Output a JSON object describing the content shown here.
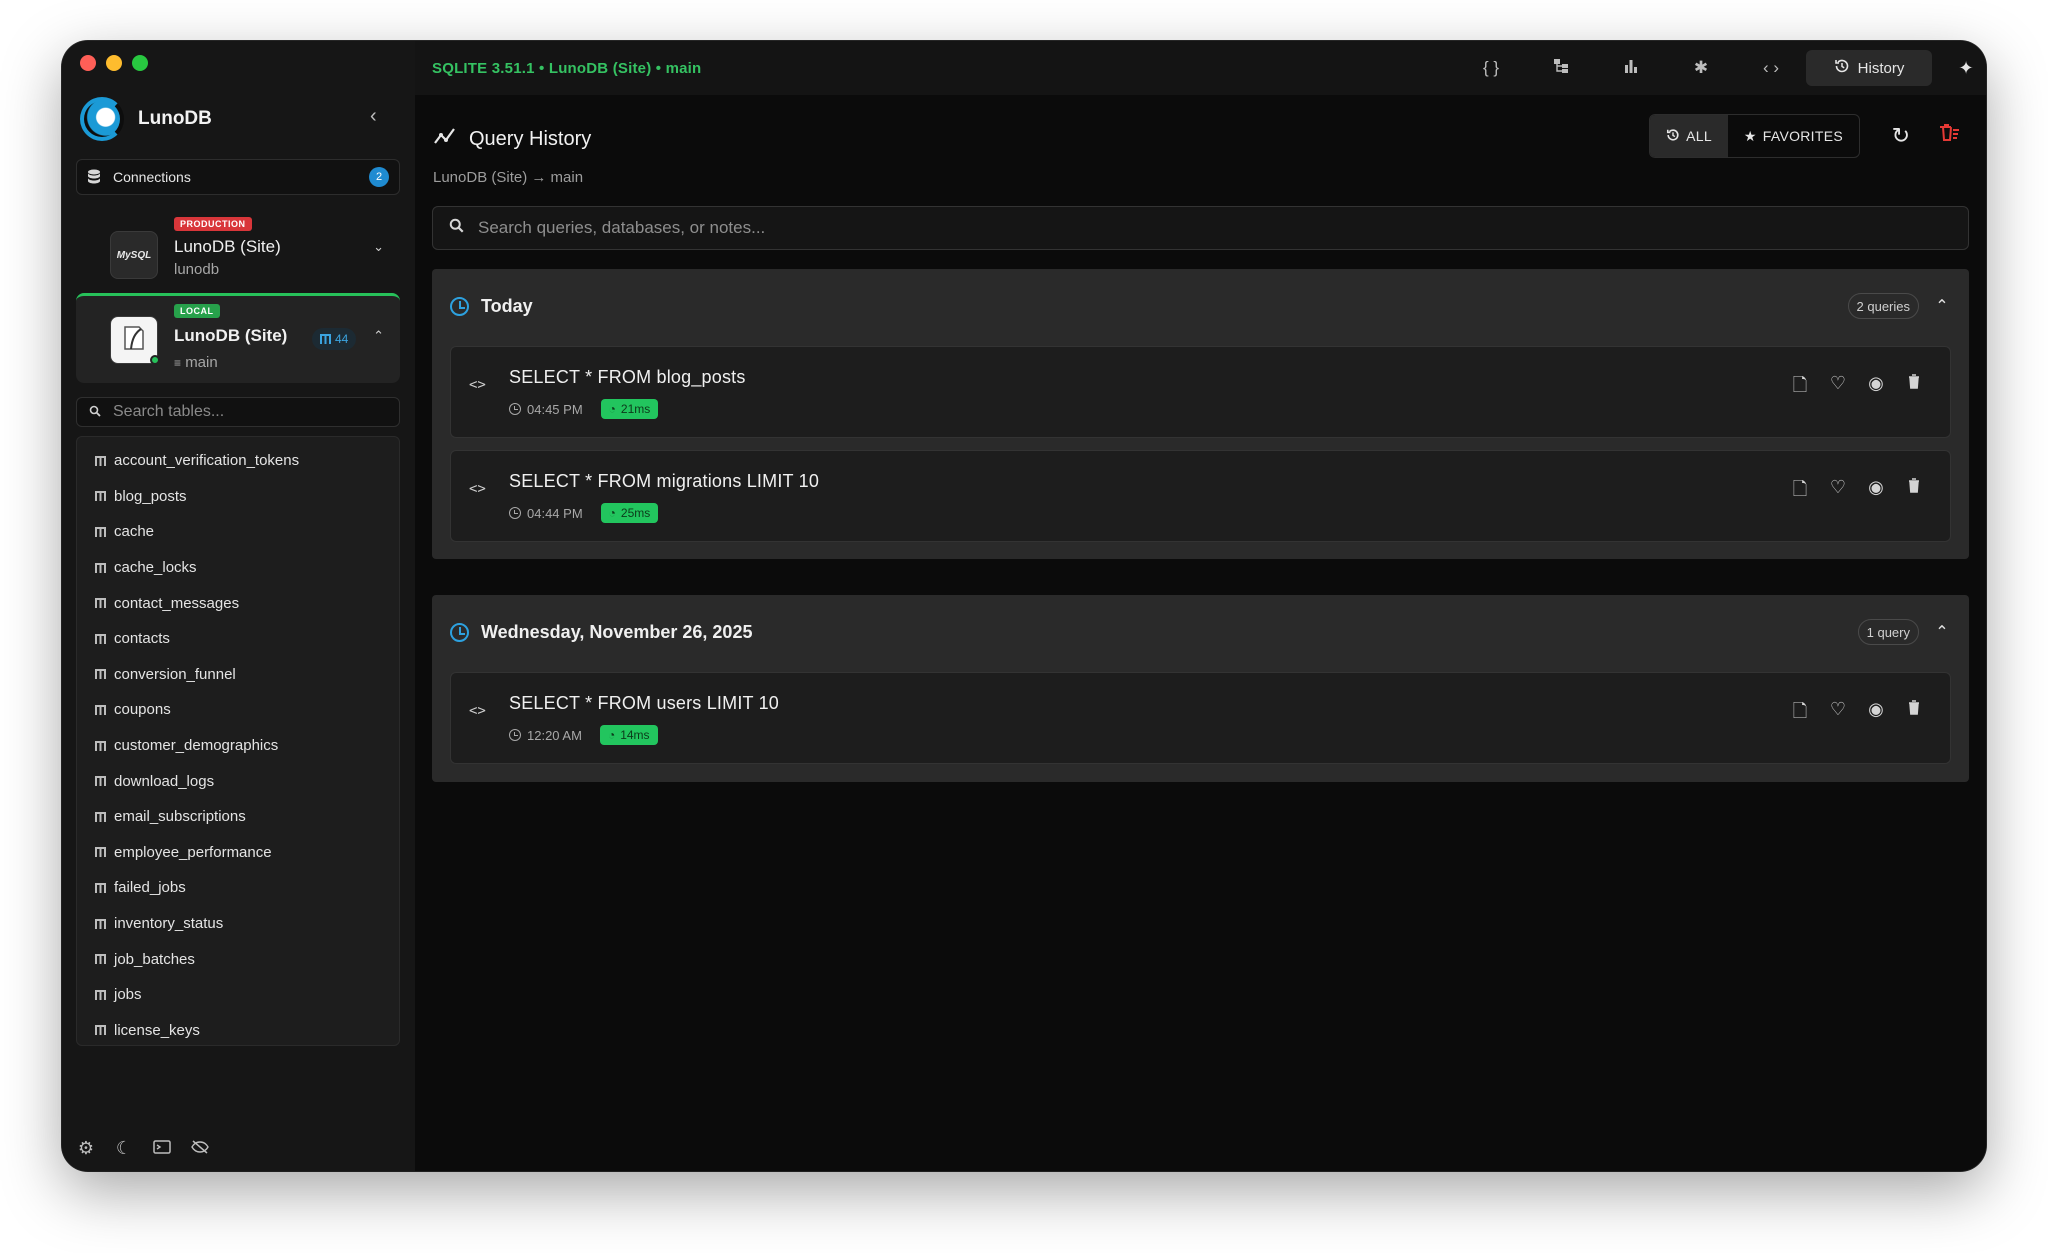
{
  "sidebar": {
    "brand": "LunoDB",
    "collapse_icon": "chevron-left-icon",
    "connections_label": "Connections",
    "connections_count": "2",
    "connections_list": [
      {
        "env": "PRODUCTION",
        "name": "LunoDB (Site)",
        "sub": "lunodb",
        "engine": "MySQL",
        "env_color": "#d9363a"
      },
      {
        "env": "LOCAL",
        "name": "LunoDB (Site)",
        "sub": "main",
        "engine": "SQLite",
        "table_count": "44",
        "env_color": "#27a14b"
      }
    ],
    "table_search_placeholder": "Search tables...",
    "tables": [
      "account_verification_tokens",
      "blog_posts",
      "cache",
      "cache_locks",
      "contact_messages",
      "contacts",
      "conversion_funnel",
      "coupons",
      "customer_demographics",
      "download_logs",
      "email_subscriptions",
      "employee_performance",
      "failed_jobs",
      "inventory_status",
      "job_batches",
      "jobs",
      "license_keys"
    ],
    "footer_icons": [
      "gear-icon",
      "moon-icon",
      "terminal-icon",
      "eye-off-icon"
    ]
  },
  "topbar": {
    "connection_status": "SQLITE 3.51.1 • LunoDB (Site) • main",
    "icons": [
      "braces-icon",
      "schema-icon",
      "chart-icon",
      "graph-icon",
      "code-icon"
    ],
    "history_label": "History",
    "ai_icon": "sparkle-icon"
  },
  "page": {
    "title": "Query History",
    "breadcrumb": "LunoDB (Site) → main",
    "filter_all": "ALL",
    "filter_favorites": "FAVORITES",
    "search_placeholder": "Search queries, databases, or notes..."
  },
  "groups": [
    {
      "title": "Today",
      "count": "2 queries",
      "queries": [
        {
          "sql": "SELECT * FROM blog_posts",
          "time": "04:45 PM",
          "duration": "21ms"
        },
        {
          "sql": "SELECT * FROM migrations LIMIT 10",
          "time": "04:44 PM",
          "duration": "25ms"
        }
      ]
    },
    {
      "title": "Wednesday, November 26, 2025",
      "count": "1 query",
      "queries": [
        {
          "sql": "SELECT * FROM users LIMIT 10",
          "time": "12:20 AM",
          "duration": "14ms"
        }
      ]
    }
  ],
  "colors": {
    "accent_green": "#22c55e",
    "accent_blue": "#2da1df",
    "danger_red": "#e53935"
  }
}
